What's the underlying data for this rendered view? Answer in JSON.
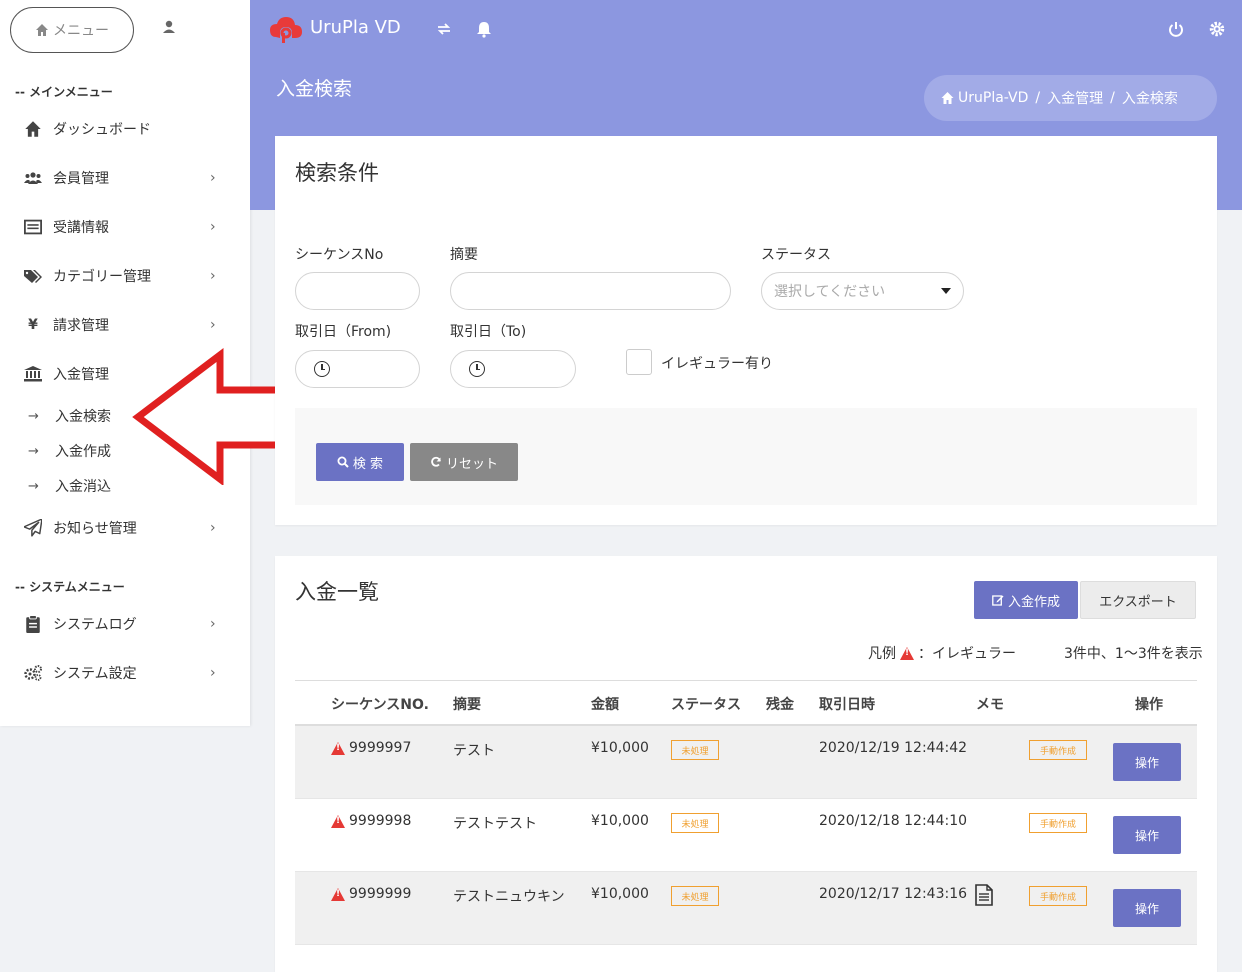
{
  "sidebar": {
    "menu_label": "メニュー",
    "main_section": "-- メインメニュー",
    "system_section": "-- システムメニュー",
    "items": [
      {
        "label": "ダッシュボード",
        "icon": "home-icon"
      },
      {
        "label": "会員管理",
        "icon": "users-icon"
      },
      {
        "label": "受講情報",
        "icon": "list-icon"
      },
      {
        "label": "カテゴリー管理",
        "icon": "tags-icon"
      },
      {
        "label": "請求管理",
        "icon": "yen-icon"
      },
      {
        "label": "入金管理",
        "icon": "bank-icon"
      },
      {
        "label": "お知らせ管理",
        "icon": "paper-plane-icon"
      }
    ],
    "sub_items": [
      {
        "label": "入金検索"
      },
      {
        "label": "入金作成"
      },
      {
        "label": "入金消込"
      }
    ],
    "system_items": [
      {
        "label": "システムログ",
        "icon": "clipboard-icon"
      },
      {
        "label": "システム設定",
        "icon": "cogs-icon"
      }
    ],
    "arrow_glyph": "→",
    "chevron_glyph": "›"
  },
  "header": {
    "brand": "UruPla VD",
    "accent_color": "#8c97e0"
  },
  "page": {
    "title": "入金検索",
    "breadcrumb": [
      "UruPla-VD",
      "入金管理",
      "入金検索"
    ],
    "breadcrumb_sep": "/"
  },
  "search": {
    "title": "検索条件",
    "sequence_label": "シーケンスNo",
    "summary_label": "摘要",
    "status_label": "ステータス",
    "status_placeholder": "選択してください",
    "date_from_label": "取引日（From)",
    "date_to_label": "取引日（To)",
    "irregular_label": "イレギュラー有り",
    "search_button": "検 索",
    "reset_button": "リセット"
  },
  "list": {
    "title": "入金一覧",
    "create_button": "入金作成",
    "export_button": "エクスポート",
    "legend_prefix": "凡例",
    "legend_text": "：イレギュラー",
    "count_text": "3件中、1～3件を表示",
    "columns": [
      "シーケンスNO.",
      "摘要",
      "金額",
      "ステータス",
      "残金",
      "取引日時",
      "メモ",
      "操作"
    ],
    "rows": [
      {
        "seq": "9999997",
        "summary": "テスト",
        "amount": "¥10,000",
        "status": "未処理",
        "date": "2020/12/19 12:44:42",
        "memo_icon": false,
        "tag": "手動作成",
        "op": "操作"
      },
      {
        "seq": "9999998",
        "summary": "テストテスト",
        "amount": "¥10,000",
        "status": "未処理",
        "date": "2020/12/18 12:44:10",
        "memo_icon": false,
        "tag": "手動作成",
        "op": "操作"
      },
      {
        "seq": "9999999",
        "summary": "テストニュウキン",
        "amount": "¥10,000",
        "status": "未処理",
        "date": "2020/12/17 12:43:16",
        "memo_icon": true,
        "tag": "手動作成",
        "op": "操作"
      }
    ]
  }
}
